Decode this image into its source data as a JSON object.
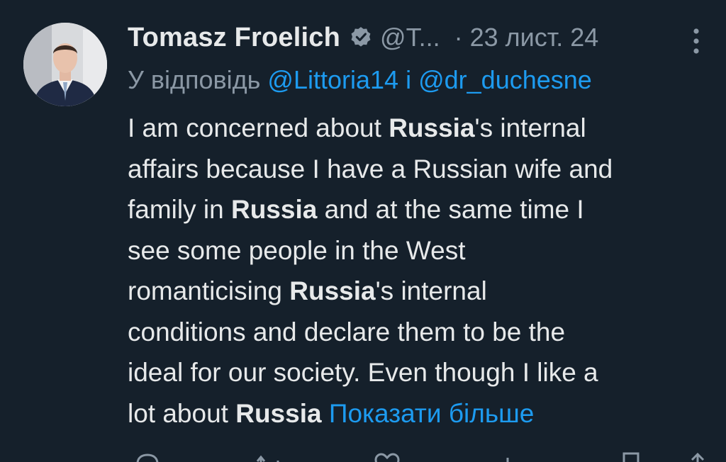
{
  "tweet": {
    "author": {
      "display_name": "Tomasz Froelich",
      "handle": "@T...",
      "verified": true,
      "avatar_icon": "profile-photo"
    },
    "separator": "·",
    "date": "23 лист. 24",
    "reply_prefix": "У відповідь",
    "reply_to_1": "@Littoria14",
    "reply_conjunction": "і",
    "reply_to_2": "@dr_duchesne",
    "text_lines": [
      {
        "a": "I am concerned about ",
        "b": "Russia",
        "c": "'s internal"
      },
      {
        "a": "affairs because I have a Russian wife and",
        "b": "",
        "c": ""
      },
      {
        "a": "family in ",
        "b": "Russia",
        "c": " and at the same time I"
      },
      {
        "a": "see some people in the West",
        "b": "",
        "c": ""
      },
      {
        "a": "romanticising ",
        "b": "Russia",
        "c": "'s internal"
      },
      {
        "a": "conditions and declare them to be the",
        "b": "",
        "c": ""
      },
      {
        "a": "ideal for our society. Even though I like a",
        "b": "",
        "c": ""
      },
      {
        "a": "lot about ",
        "b": "Russia",
        "c": " "
      }
    ],
    "show_more": "Показати більше",
    "actions": [
      "reply-icon",
      "retweet-icon",
      "like-icon",
      "views-icon",
      "bookmark-icon",
      "share-icon"
    ]
  },
  "colors": {
    "background": "#15202b",
    "text": "#e7e9ea",
    "muted": "#8b98a5",
    "accent": "#1d9bf0"
  }
}
